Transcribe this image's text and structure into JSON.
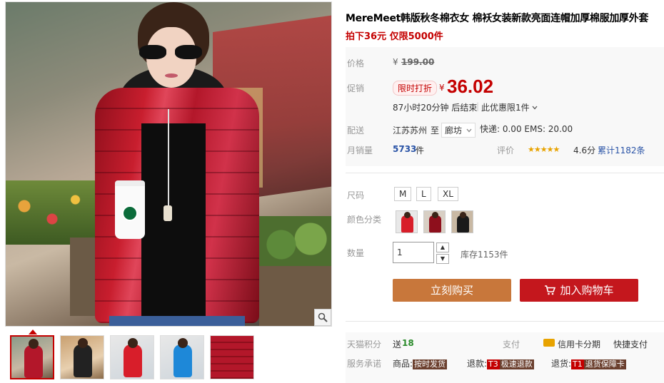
{
  "product": {
    "title": "MereMeet韩版秋冬棉衣女 棉袄女装新款亮面连帽加厚棉服加厚外套",
    "subtitle": "拍下36元 仅限5000件"
  },
  "price": {
    "label": "价格",
    "currency": "¥",
    "original": "199.00"
  },
  "promo": {
    "label": "促销",
    "tag": "限时打折",
    "currency": "¥",
    "price": "36.02",
    "countdown": "87小时20分钟 后结束",
    "limit": "此优惠限1件"
  },
  "shipping": {
    "label": "配送",
    "from": "江苏苏州",
    "to_word": "至",
    "destination": "廊坊",
    "fees": "快递: 0.00 EMS: 20.00"
  },
  "sales": {
    "label": "月销量",
    "count": "5733",
    "unit": "件",
    "rating_label": "评价",
    "stars": "★★★★★",
    "score": "4.6分",
    "reviews": "累计1182条"
  },
  "size": {
    "label": "尺码",
    "options": [
      "M",
      "L",
      "XL"
    ]
  },
  "color": {
    "label": "颜色分类"
  },
  "quantity": {
    "label": "数量",
    "value": "1",
    "stock": "库存1153件",
    "up": "▲",
    "down": "▼"
  },
  "actions": {
    "buy": "立刻购买",
    "cart": "加入购物车"
  },
  "footer": {
    "points_label": "天猫积分",
    "points_prefix": "送",
    "points_value": "18",
    "pay_label": "支付",
    "credit": "信用卡分期",
    "quick_pay": "快捷支付",
    "service_label": "服务承诺",
    "goods_prefix": "商品:",
    "goods_tag": "按时发货",
    "refund_prefix": "退款:",
    "refund_code": "T3",
    "refund_tag": "极速退款",
    "return_prefix": "退货:",
    "return_code": "T1",
    "return_tag": "退货保障卡"
  },
  "colors": {
    "accent": "#c40000",
    "buy_button": "#c8773b",
    "cart_button": "#c4171d",
    "star": "#e8a300"
  },
  "icons": [
    "zoom-icon",
    "chevron-down-icon",
    "cart-icon",
    "credit-card-icon"
  ]
}
